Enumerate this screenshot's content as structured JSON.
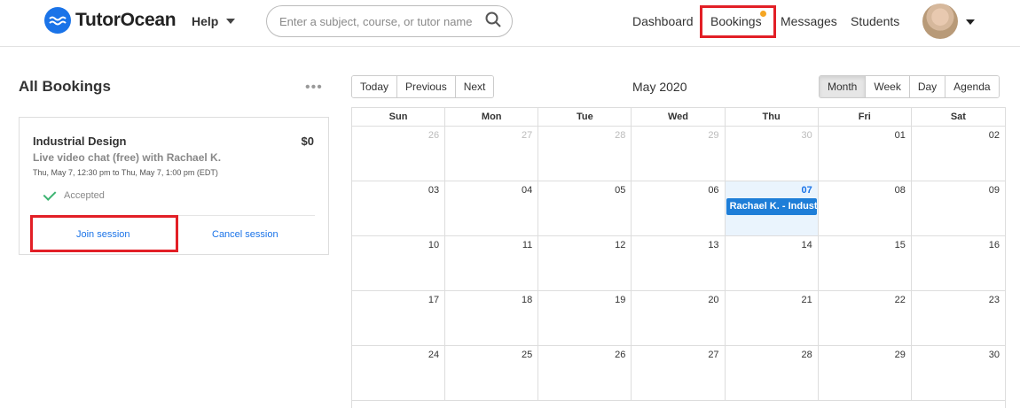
{
  "header": {
    "logo_text": "TutorOcean",
    "help_label": "Help",
    "search_placeholder": "Enter a subject, course, or tutor name",
    "nav": [
      "Dashboard",
      "Bookings",
      "Messages",
      "Students"
    ]
  },
  "left": {
    "title": "All Bookings",
    "more": "•••",
    "card": {
      "title": "Industrial Design",
      "price": "$0",
      "subtitle": "Live video chat (free) with Rachael K.",
      "time": "Thu, May 7, 12:30 pm to Thu, May 7, 1:00 pm (EDT)",
      "status": "Accepted",
      "join_label": "Join session",
      "cancel_label": "Cancel session"
    }
  },
  "calendar": {
    "nav_buttons": [
      "Today",
      "Previous",
      "Next"
    ],
    "title": "May 2020",
    "view_buttons": [
      "Month",
      "Week",
      "Day",
      "Agenda"
    ],
    "active_view": "Month",
    "weekdays": [
      "Sun",
      "Mon",
      "Tue",
      "Wed",
      "Thu",
      "Fri",
      "Sat"
    ],
    "weeks": [
      [
        "26",
        "27",
        "28",
        "29",
        "30",
        "01",
        "02"
      ],
      [
        "03",
        "04",
        "05",
        "06",
        "07",
        "08",
        "09"
      ],
      [
        "10",
        "11",
        "12",
        "13",
        "14",
        "15",
        "16"
      ],
      [
        "17",
        "18",
        "19",
        "20",
        "21",
        "22",
        "23"
      ],
      [
        "24",
        "25",
        "26",
        "27",
        "28",
        "29",
        "30"
      ]
    ],
    "event": {
      "label": "Rachael K. - Industrial Design"
    }
  },
  "colors": {
    "accent": "#1a73e8",
    "highlight": "#e21f26",
    "event": "#1e7ed8",
    "today_bg": "#eaf4fd"
  }
}
